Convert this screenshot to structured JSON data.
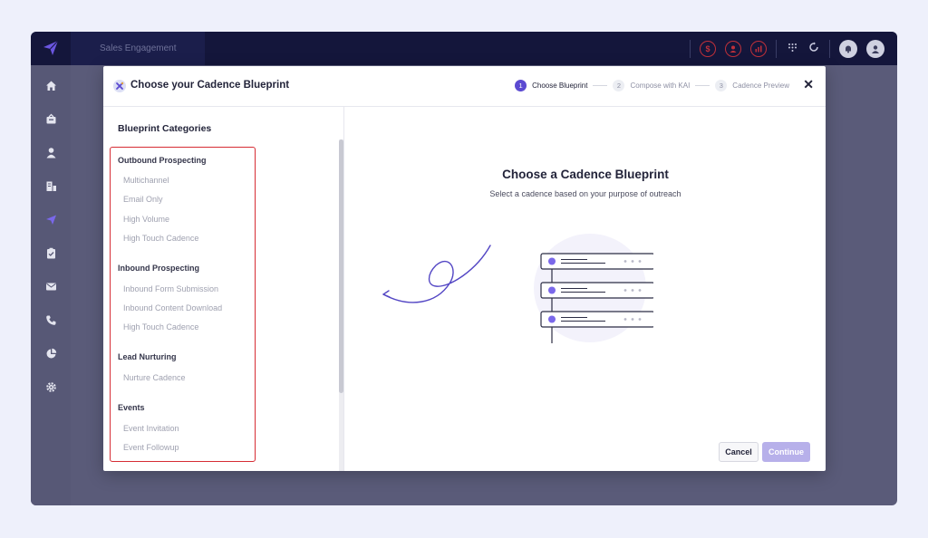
{
  "app": {
    "tab_title": "Sales Engagement"
  },
  "icons": {
    "logo": "paper-plane-icon",
    "topbar": [
      "dollar-icon",
      "contact-icon",
      "chart-icon",
      "dialpad-icon",
      "refresh-icon",
      "notification-icon",
      "user-avatar-icon"
    ],
    "sidenav": [
      "home-icon",
      "inbox-icon",
      "user-icon",
      "accounts-icon",
      "cadence-icon",
      "tasks-icon",
      "email-icon",
      "phone-icon",
      "reports-icon",
      "settings-icon"
    ]
  },
  "modal": {
    "title": "Choose your Cadence Blueprint",
    "steps": [
      {
        "num": "1",
        "label": "Choose Blueprint"
      },
      {
        "num": "2",
        "label": "Compose with KAI"
      },
      {
        "num": "3",
        "label": "Cadence Preview"
      }
    ],
    "close": "✕"
  },
  "left": {
    "title": "Blueprint Categories",
    "categories": [
      {
        "heading": "Outbound Prospecting",
        "items": [
          "Multichannel",
          "Email Only",
          "High Volume",
          "High Touch Cadence"
        ]
      },
      {
        "heading": "Inbound Prospecting",
        "items": [
          "Inbound Form Submission",
          "Inbound Content Download",
          "High Touch Cadence"
        ]
      },
      {
        "heading": "Lead Nurturing",
        "items": [
          "Nurture Cadence"
        ]
      },
      {
        "heading": "Events",
        "items": [
          "Event Invitation",
          "Event Followup"
        ]
      }
    ]
  },
  "right": {
    "title": "Choose a Cadence Blueprint",
    "subtitle": "Select a cadence based on your purpose of outreach",
    "cancel": "Cancel",
    "continue": "Continue"
  },
  "colors": {
    "accent": "#5b4ad1",
    "highlight_border": "#d62c34",
    "topbar": "#14163b",
    "alert": "#c0303a"
  }
}
